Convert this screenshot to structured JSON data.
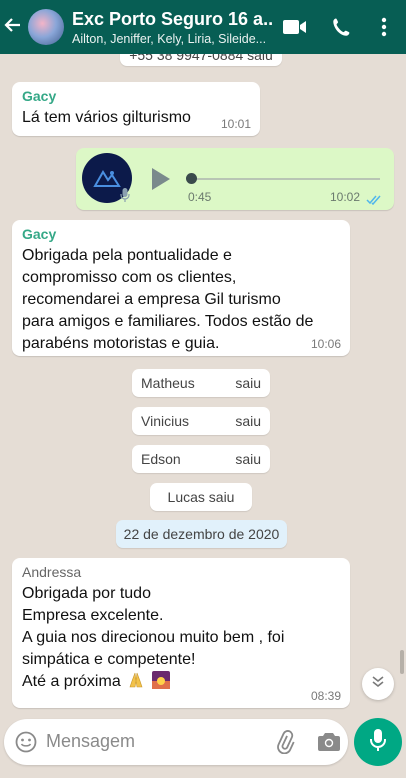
{
  "header": {
    "back_icon": "arrow-left-icon",
    "title": "Exc Porto Seguro 16 a...",
    "subtitle": "Ailton, Jeniffer, Kely, Liria, Sileide..."
  },
  "messages": {
    "top_partial_text": "+55 38 9947-0884 saiu",
    "gacy1": {
      "sender": "Gacy",
      "text": "Lá tem vários gilturismo",
      "time": "10:01"
    },
    "voice": {
      "duration": "0:45",
      "time": "10:02",
      "status": "read"
    },
    "gacy2": {
      "sender": "Gacy",
      "lines": [
        "Obrigada pela pontualidade e",
        "compromisso com os clientes,",
        "recomendarei a empresa Gil turismo",
        "para amigos e familiares. Todos estão de",
        "parabéns motoristas e guia."
      ],
      "time": "10:06"
    },
    "system": [
      {
        "name": "Matheus",
        "action": "saiu"
      },
      {
        "name": "Vinicius",
        "action": "saiu"
      },
      {
        "name": "Edson",
        "action": "saiu"
      },
      {
        "text": "Lucas saiu"
      }
    ],
    "date_divider": "22 de dezembro de 2020",
    "andressa": {
      "sender": "Andressa",
      "lines": [
        "Obrigada por tudo",
        "Empresa excelente.",
        "A guia nos direcionou muito bem , foi",
        "simpática e competente!",
        "Até a próxima"
      ],
      "time": "08:39"
    }
  },
  "input": {
    "placeholder": "Mensagem"
  },
  "colors": {
    "header": "#075e54",
    "accent": "#00a884",
    "outgoing": "#dcf8c6",
    "sender": "#35a887"
  }
}
